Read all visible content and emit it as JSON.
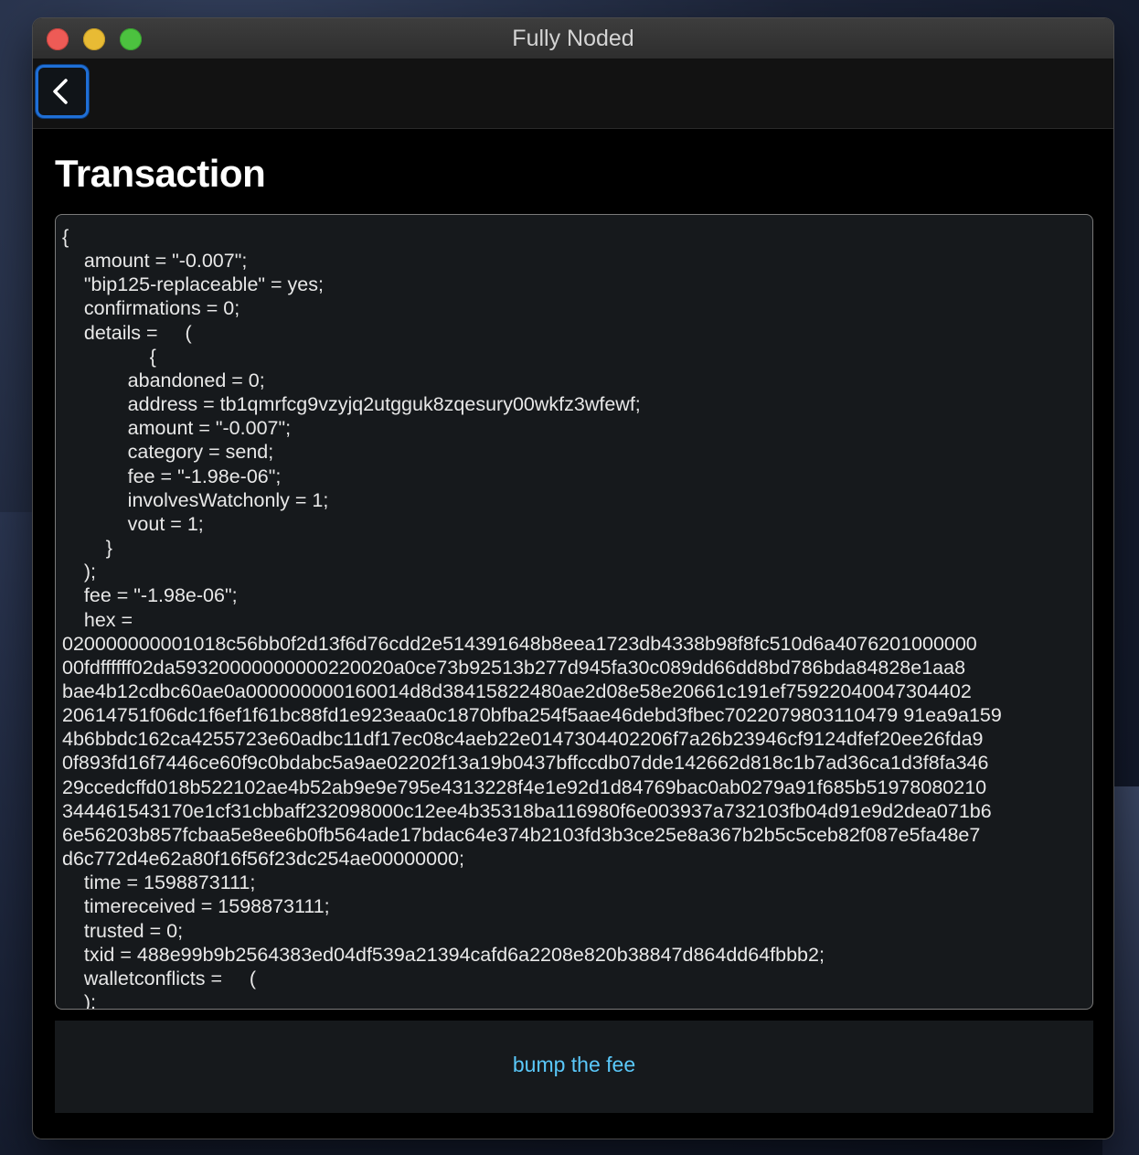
{
  "window": {
    "title": "Fully Noded"
  },
  "page": {
    "title": "Transaction"
  },
  "transaction": {
    "raw_text": "{\n    amount = \"-0.007\";\n    \"bip125-replaceable\" = yes;\n    confirmations = 0;\n    details =     (\n                {\n            abandoned = 0;\n            address = tb1qmrfcg9vzyjq2utgguk8zqesury00wkfz3wfewf;\n            amount = \"-0.007\";\n            category = send;\n            fee = \"-1.98e-06\";\n            involvesWatchonly = 1;\n            vout = 1;\n        }\n    );\n    fee = \"-1.98e-06\";\n    hex = \n020000000001018c56bb0f2d13f6d76cdd2e514391648b8eea1723db4338b98f8fc510d6a4076201000000\n00fdffffff02da59320000000000220020a0ce73b92513b277d945fa30c089dd66dd8bd786bda84828e1aa8\nbae4b12cdbc60ae0a000000000160014d8d38415822480ae2d08e58e20661c191ef75922040047304402\n20614751f06dc1f6ef1f61bc88fd1e923eaa0c1870bfba254f5aae46debd3fbec7022079803110479 91ea9a159\n4b6bbdc162ca4255723e60adbc11df17ec08c4aeb22e0147304402206f7a26b23946cf9124dfef20ee26fda9\n0f893fd16f7446ce60f9c0bdabc5a9ae02202f13a19b0437bffccdb07dde142662d818c1b7ad36ca1d3f8fa346\n29ccedcffd018b522102ae4b52ab9e9e795e4313228f4e1e92d1d84769bac0ab0279a91f685b51978080210\n344461543170e1cf31cbbaff232098000c12ee4b35318ba116980f6e003937a732103fb04d91e9d2dea071b6\n6e56203b857fcbaa5e8ee6b0fb564ade17bdac64e374b2103fd3b3ce25e8a367b2b5c5ceb82f087e5fa48e7\nd6c772d4e62a80f16f56f23dc254ae00000000;\n    time = 1598873111;\n    timereceived = 1598873111;\n    trusted = 0;\n    txid = 488e99b9b2564383ed04df539a21394cafd6a2208e820b38847d864dd64fbbb2;\n    walletconflicts =     (\n    );"
  },
  "actions": {
    "bump_fee_label": "bump the fee"
  },
  "colors": {
    "accent": "#5ac8fa",
    "focus_ring": "#1f6fd6",
    "close": "#ee5b56",
    "minimize": "#e8bb34",
    "maximize": "#4cc23f"
  },
  "icons": {
    "back": "chevron-left-icon"
  }
}
